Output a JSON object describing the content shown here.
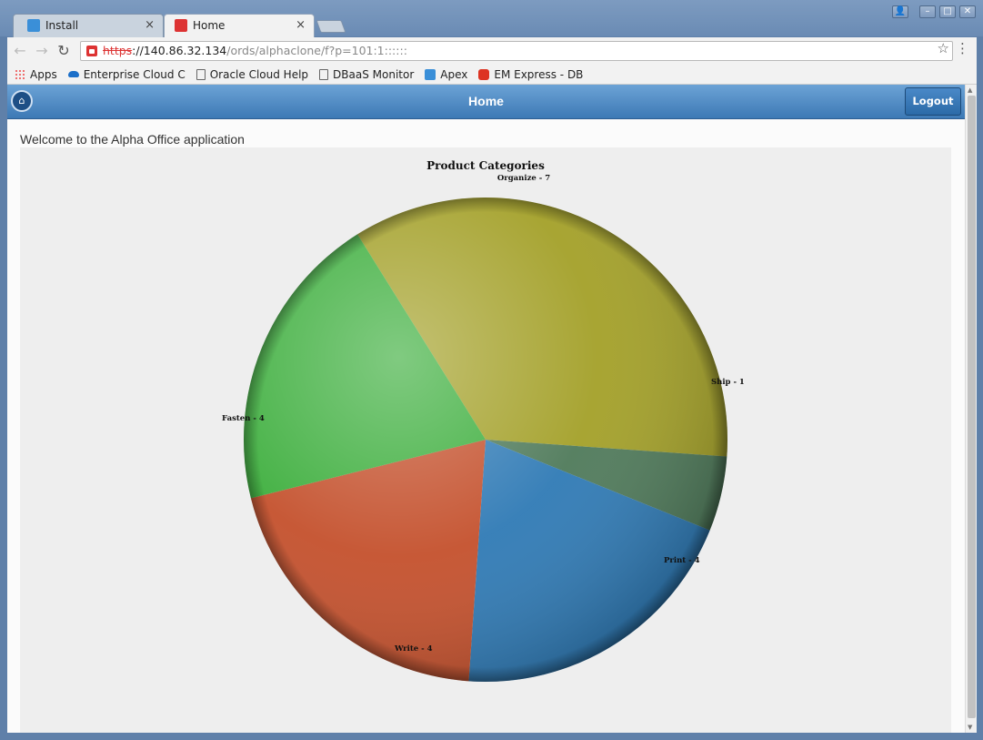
{
  "browser": {
    "tabs": [
      {
        "label": "Install",
        "active": false
      },
      {
        "label": "Home",
        "active": true
      }
    ],
    "close_glyph": "×",
    "url": {
      "scheme": "https",
      "host": "://140.86.32.134",
      "path": "/ords/alphaclone/f?p=101:1::::::"
    },
    "bookmarks": [
      {
        "label": "Apps",
        "icon": "apps-icon"
      },
      {
        "label": "Enterprise Cloud C",
        "icon": "cloud-icon"
      },
      {
        "label": "Oracle Cloud Help",
        "icon": "page-icon"
      },
      {
        "label": "DBaaS Monitor",
        "icon": "page-icon"
      },
      {
        "label": "Apex",
        "icon": "apex-icon"
      },
      {
        "label": "EM Express - DB",
        "icon": "em-icon"
      }
    ]
  },
  "app": {
    "header_title": "Home",
    "logout_label": "Logout",
    "welcome_text": "Welcome to the Alpha Office application"
  },
  "chart_data": {
    "type": "pie",
    "title": "Product Categories",
    "categories": [
      "Organize",
      "Ship",
      "Print",
      "Write",
      "Fasten"
    ],
    "values": [
      7,
      1,
      4,
      4,
      4
    ],
    "labels": [
      "Organize - 7",
      "Ship - 1",
      "Print - 4",
      "Write - 4",
      "Fasten - 4"
    ],
    "colors": [
      "#a3a028",
      "#4f7a5a",
      "#2f7ab5",
      "#c4502c",
      "#3cae3c"
    ]
  }
}
